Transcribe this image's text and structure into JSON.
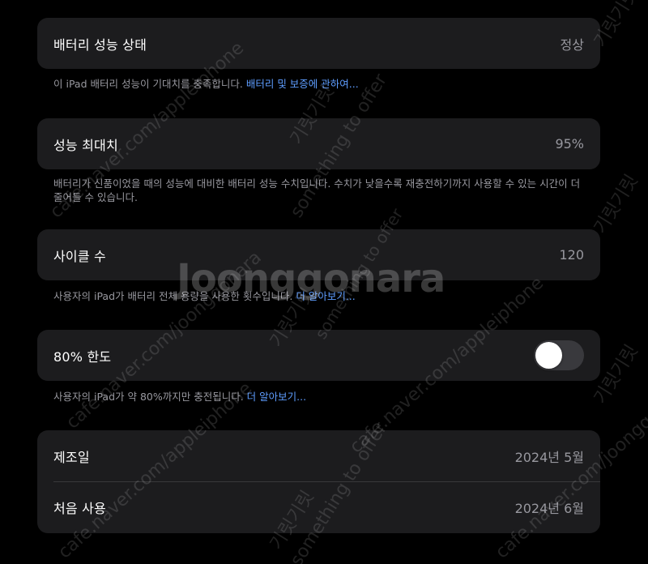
{
  "colors": {
    "background": "#000000",
    "card": "#1c1c1e",
    "secondary_text": "#98989f",
    "link": "#5e9dff",
    "toggle_off": "#39393d"
  },
  "health": {
    "label": "배터리 성능 상태",
    "value": "정상",
    "footnote_text": "이 iPad 배터리 성능이 기대치를 충족합니다. ",
    "footnote_link": "배터리 및 보증에 관하여..."
  },
  "max_capacity": {
    "label": "성능 최대치",
    "value": "95%",
    "footnote_text": "배터리가 신품이었을 때의 성능에 대비한 배터리 성능 수치입니다. 수치가 낮을수록 재충전하기까지 사용할 수 있는 시간이 더 줄어들 수 있습니다."
  },
  "cycle_count": {
    "label": "사이클 수",
    "value": "120",
    "footnote_text": "사용자의 iPad가 배터리 전체 용량을 사용한 횟수입니다. ",
    "footnote_link": "더 알아보기..."
  },
  "limit_80": {
    "label": "80% 한도",
    "toggle_on": false,
    "footnote_text": "사용자의 iPad가 약 80%까지만 충전됩니다. ",
    "footnote_link": "더 알아보기..."
  },
  "dates": {
    "manufacture_label": "제조일",
    "manufacture_value": "2024년 5월",
    "first_use_label": "처음 사용",
    "first_use_value": "2024년 6월"
  },
  "watermark": {
    "center_text": "Joonggonara",
    "texts": [
      "cafe.naver.com/appleiphone",
      "cafe.naver.com/joonggonara",
      "something to offer",
      "기릿기릿"
    ]
  }
}
